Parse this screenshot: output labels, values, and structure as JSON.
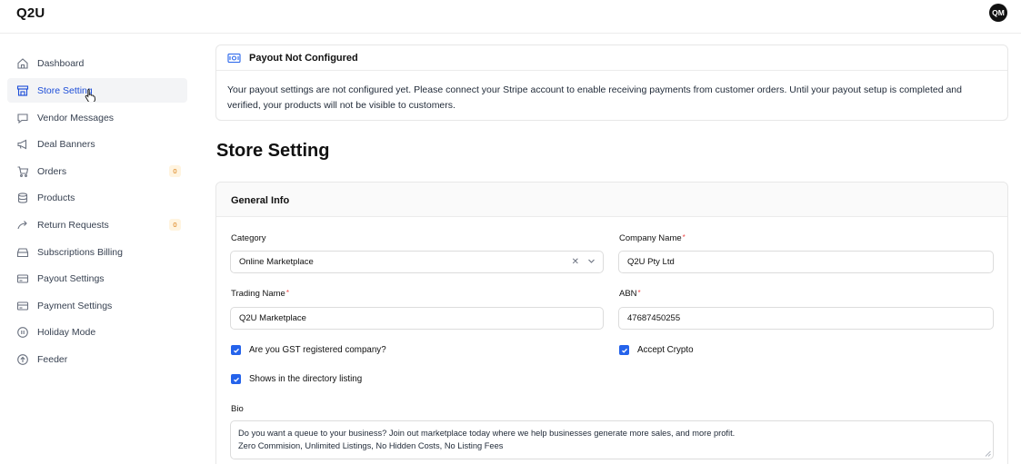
{
  "header": {
    "logo": "Q2U",
    "avatar_initials": "QM"
  },
  "sidebar": {
    "items": [
      {
        "label": "Dashboard",
        "icon": "home-icon"
      },
      {
        "label": "Store Setting",
        "icon": "store-icon",
        "active": true
      },
      {
        "label": "Vendor Messages",
        "icon": "message-icon"
      },
      {
        "label": "Deal Banners",
        "icon": "megaphone-icon"
      },
      {
        "label": "Orders",
        "icon": "cart-icon",
        "badge": "0"
      },
      {
        "label": "Products",
        "icon": "database-icon"
      },
      {
        "label": "Return Requests",
        "icon": "return-arrow-icon",
        "badge": "0"
      },
      {
        "label": "Subscriptions Billing",
        "icon": "tray-icon"
      },
      {
        "label": "Payout Settings",
        "icon": "card-icon"
      },
      {
        "label": "Payment Settings",
        "icon": "card-icon"
      },
      {
        "label": "Holiday Mode",
        "icon": "pause-circle-icon"
      },
      {
        "label": "Feeder",
        "icon": "cloud-upload-icon"
      }
    ]
  },
  "payout_notice": {
    "title": "Payout Not Configured",
    "message": "Your payout settings are not configured yet. Please connect your Stripe account to enable receiving payments from customer orders. Until your payout setup is completed and verified, your products will not be visible to customers."
  },
  "page": {
    "title": "Store Setting"
  },
  "general_info": {
    "title": "General Info",
    "category": {
      "label": "Category",
      "value": "Online Marketplace"
    },
    "company_name": {
      "label": "Company Name",
      "value": "Q2U Pty Ltd",
      "required": "*"
    },
    "trading_name": {
      "label": "Trading Name",
      "value": "Q2U Marketplace",
      "required": "*"
    },
    "abn": {
      "label": "ABN",
      "value": "47687450255",
      "required": "*"
    },
    "gst": {
      "label": "Are you GST registered company?",
      "checked": true
    },
    "crypto": {
      "label": "Accept Crypto",
      "checked": true
    },
    "directory": {
      "label": "Shows in the directory listing",
      "checked": true
    },
    "bio": {
      "label": "Bio",
      "line1": "Do you want a queue to your business? Join out marketplace today where we help businesses generate more sales, and more profit.",
      "line2": "Zero Commision, Unlimited Listings, No Hidden Costs, No Listing Fees"
    }
  },
  "colors": {
    "accent": "#2563eb",
    "badge_bg": "#fff4e0",
    "badge_text": "#d97706",
    "required": "#ef4444"
  }
}
